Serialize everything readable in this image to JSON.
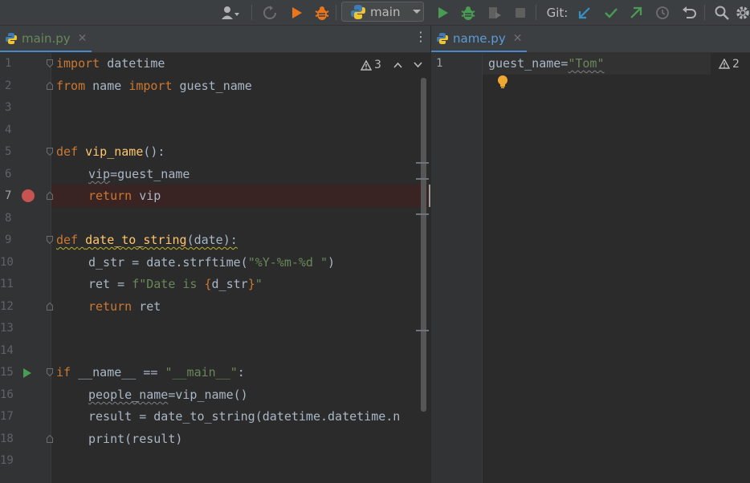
{
  "toolbar": {
    "branch_label": "main",
    "git_label": "Git:"
  },
  "left_editor": {
    "tab_label": "main.py",
    "line_numbers": [
      "1",
      "2",
      "3",
      "4",
      "5",
      "6",
      "7",
      "8",
      "9",
      "10",
      "11",
      "12",
      "13",
      "14",
      "15",
      "16",
      "17",
      "18",
      "19"
    ],
    "warning_count": "3",
    "code": {
      "l1_kw": "import",
      "l1_rest": " datetime",
      "l2_kw1": "from",
      "l2_mid": " name ",
      "l2_kw2": "import",
      "l2_rest": " guest_name",
      "l5_kw": "def",
      "l5_fn": "vip_name",
      "l5_rest": "():",
      "l6_a": "vip",
      "l6_b": "=guest_name",
      "l7_kw": "return",
      "l7_rest": " vip",
      "l9_kw": "def",
      "l9_fn": "date_to_string",
      "l9_rest": "(date):",
      "l10_a": "d_str = date.strftime(",
      "l10_str": "\"%Y-%m-%d \"",
      "l10_b": ")",
      "l11_a": "ret = ",
      "l11_str1": "f\"Date is ",
      "l11_brace1": "{",
      "l11_var": "d_str",
      "l11_brace2": "}",
      "l11_str2": "\"",
      "l12_kw": "return",
      "l12_rest": " ret",
      "l15_kw": "if",
      "l15_a": " __name__ == ",
      "l15_str": "\"__main__\"",
      "l15_b": ":",
      "l16_a": "people_name",
      "l16_b": "=vip_name()",
      "l17": "result = date_to_string(datetime.datetime.n",
      "l18": "print(result)"
    }
  },
  "right_editor": {
    "tab_label": "name.py",
    "line_number": "1",
    "warning_count": "2",
    "code_a": "guest_name",
    "code_b": "=",
    "code_str": "\"Tom\""
  },
  "colors": {
    "keyword": "#cc7832",
    "function": "#ffc66d",
    "string": "#6a8759",
    "text": "#a9b7c6",
    "breakpoint": "#c75450",
    "run": "#499c54"
  }
}
